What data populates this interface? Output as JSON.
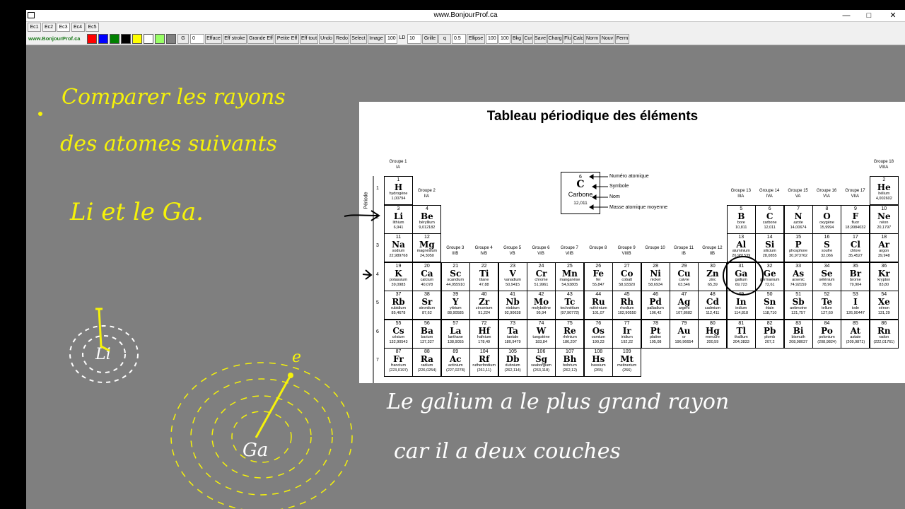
{
  "window": {
    "title": "www.BonjourProf.ca",
    "minimize": "—",
    "maximize": "□",
    "close": "✕"
  },
  "tabs": [
    {
      "label": "Ec1",
      "active": false
    },
    {
      "label": "Ec2",
      "active": false
    },
    {
      "label": "Ec3",
      "active": true
    },
    {
      "label": "Ec4",
      "active": false
    },
    {
      "label": "Ec5",
      "active": false
    }
  ],
  "toolbar": {
    "site": "www.BonjourProf.ca",
    "swatches": [
      "#ff0000",
      "#0000ff",
      "#008000",
      "#000000",
      "#ffff00",
      "#ffffff",
      "#99ff66",
      "#808080"
    ],
    "items": [
      {
        "text": "G",
        "kind": "btn"
      },
      {
        "text": "0",
        "kind": "val"
      },
      {
        "text": "Efface",
        "kind": "btn"
      },
      {
        "text": "Eff stroke",
        "kind": "btn"
      },
      {
        "text": "Grande Eff",
        "kind": "btn"
      },
      {
        "text": "Petite Eff",
        "kind": "btn"
      },
      {
        "text": "Eff tout",
        "kind": "btn"
      },
      {
        "text": "Undo",
        "kind": "btn"
      },
      {
        "text": "Redo",
        "kind": "btn"
      },
      {
        "text": "Select",
        "kind": "btn"
      },
      {
        "text": "Image",
        "kind": "btn"
      },
      {
        "text": "100",
        "kind": "val"
      },
      {
        "text": "LD",
        "kind": "lbl"
      },
      {
        "text": "10",
        "kind": "val"
      },
      {
        "text": "Grille",
        "kind": "btn"
      },
      {
        "text": "q",
        "kind": "btn"
      },
      {
        "text": "0.5",
        "kind": "val"
      },
      {
        "text": "Ellipse",
        "kind": "btn"
      },
      {
        "text": "100",
        "kind": "val"
      },
      {
        "text": "100",
        "kind": "val"
      },
      {
        "text": "Bkg",
        "kind": "btn"
      },
      {
        "text": "Cur",
        "kind": "btn"
      },
      {
        "text": "Save",
        "kind": "btn"
      },
      {
        "text": "Charg",
        "kind": "btn"
      },
      {
        "text": "Flu",
        "kind": "btn"
      },
      {
        "text": "Calc",
        "kind": "btn"
      },
      {
        "text": "Norm",
        "kind": "btn"
      },
      {
        "text": "Nouv",
        "kind": "btn"
      },
      {
        "text": "Ferm",
        "kind": "btn"
      }
    ]
  },
  "periodic_table": {
    "title": "Tableau périodique des éléments",
    "period_label": "Période",
    "legend": {
      "number": "6",
      "symbol": "C",
      "name": "Carbone",
      "mass": "12,011",
      "labels": [
        "Numéro atomique",
        "Symbole",
        "Nom",
        "Masse atomique moyenne"
      ]
    },
    "groups": [
      {
        "col": 1,
        "row": 1,
        "line1": "Groupe 1",
        "line2": "IA"
      },
      {
        "col": 2,
        "row": 2,
        "line1": "Groupe 2",
        "line2": "IIA"
      },
      {
        "col": 3,
        "row": 4,
        "line1": "Groupe 3",
        "line2": "IIIB"
      },
      {
        "col": 4,
        "row": 4,
        "line1": "Groupe 4",
        "line2": "IVB"
      },
      {
        "col": 5,
        "row": 4,
        "line1": "Groupe 5",
        "line2": "VB"
      },
      {
        "col": 6,
        "row": 4,
        "line1": "Groupe 6",
        "line2": "VIB"
      },
      {
        "col": 7,
        "row": 4,
        "line1": "Groupe 7",
        "line2": "VIIB"
      },
      {
        "col": 8,
        "row": 4,
        "line1": "Groupe 8",
        "line2": ""
      },
      {
        "col": 9,
        "row": 4,
        "line1": "Groupe 9",
        "line2": "VIIIB"
      },
      {
        "col": 10,
        "row": 4,
        "line1": "Groupe 10",
        "line2": ""
      },
      {
        "col": 11,
        "row": 4,
        "line1": "Groupe 11",
        "line2": "IB"
      },
      {
        "col": 12,
        "row": 4,
        "line1": "Groupe 12",
        "line2": "IIB"
      },
      {
        "col": 13,
        "row": 2,
        "line1": "Groupe 13",
        "line2": "IIIA"
      },
      {
        "col": 14,
        "row": 2,
        "line1": "Groupe 14",
        "line2": "IVA"
      },
      {
        "col": 15,
        "row": 2,
        "line1": "Groupe 15",
        "line2": "VA"
      },
      {
        "col": 16,
        "row": 2,
        "line1": "Groupe 16",
        "line2": "VIA"
      },
      {
        "col": 17,
        "row": 2,
        "line1": "Groupe 17",
        "line2": "VIIA"
      },
      {
        "col": 18,
        "row": 1,
        "line1": "Groupe 18",
        "line2": "VIIIA"
      }
    ],
    "periods": [
      "1",
      "2",
      "3",
      "4",
      "5",
      "6",
      "7"
    ],
    "elements": [
      {
        "n": "1",
        "s": "H",
        "name": "hydrogène",
        "m": "1,00794",
        "row": 1,
        "col": 1
      },
      {
        "n": "2",
        "s": "He",
        "name": "hélium",
        "m": "4,002602",
        "row": 1,
        "col": 18
      },
      {
        "n": "3",
        "s": "Li",
        "name": "lithium",
        "m": "6,941",
        "row": 2,
        "col": 1
      },
      {
        "n": "4",
        "s": "Be",
        "name": "béryllium",
        "m": "9,012182",
        "row": 2,
        "col": 2
      },
      {
        "n": "5",
        "s": "B",
        "name": "bore",
        "m": "10,811",
        "row": 2,
        "col": 13
      },
      {
        "n": "6",
        "s": "C",
        "name": "carbone",
        "m": "12,011",
        "row": 2,
        "col": 14
      },
      {
        "n": "7",
        "s": "N",
        "name": "azote",
        "m": "14,00674",
        "row": 2,
        "col": 15
      },
      {
        "n": "8",
        "s": "O",
        "name": "oxygène",
        "m": "15,9994",
        "row": 2,
        "col": 16
      },
      {
        "n": "9",
        "s": "F",
        "name": "fluor",
        "m": "18,9984032",
        "row": 2,
        "col": 17
      },
      {
        "n": "10",
        "s": "Ne",
        "name": "néon",
        "m": "20,1797",
        "row": 2,
        "col": 18
      },
      {
        "n": "11",
        "s": "Na",
        "name": "sodium",
        "m": "22,989768",
        "row": 3,
        "col": 1
      },
      {
        "n": "12",
        "s": "Mg",
        "name": "magnésium",
        "m": "24,3050",
        "row": 3,
        "col": 2
      },
      {
        "n": "13",
        "s": "Al",
        "name": "aluminium",
        "m": "26,981539",
        "row": 3,
        "col": 13
      },
      {
        "n": "14",
        "s": "Si",
        "name": "silicium",
        "m": "28,0855",
        "row": 3,
        "col": 14
      },
      {
        "n": "15",
        "s": "P",
        "name": "phosphore",
        "m": "30,973762",
        "row": 3,
        "col": 15
      },
      {
        "n": "16",
        "s": "S",
        "name": "soufre",
        "m": "32,066",
        "row": 3,
        "col": 16
      },
      {
        "n": "17",
        "s": "Cl",
        "name": "chlore",
        "m": "35,4527",
        "row": 3,
        "col": 17
      },
      {
        "n": "18",
        "s": "Ar",
        "name": "argon",
        "m": "39,948",
        "row": 3,
        "col": 18
      },
      {
        "n": "19",
        "s": "K",
        "name": "potassium",
        "m": "39,0983",
        "row": 4,
        "col": 1
      },
      {
        "n": "20",
        "s": "Ca",
        "name": "calcium",
        "m": "40,078",
        "row": 4,
        "col": 2
      },
      {
        "n": "21",
        "s": "Sc",
        "name": "scandium",
        "m": "44,955910",
        "row": 4,
        "col": 3
      },
      {
        "n": "22",
        "s": "Ti",
        "name": "titane",
        "m": "47,88",
        "row": 4,
        "col": 4
      },
      {
        "n": "23",
        "s": "V",
        "name": "vanadium",
        "m": "50,9415",
        "row": 4,
        "col": 5
      },
      {
        "n": "24",
        "s": "Cr",
        "name": "chrome",
        "m": "51,9961",
        "row": 4,
        "col": 6
      },
      {
        "n": "25",
        "s": "Mn",
        "name": "manganèse",
        "m": "54,93805",
        "row": 4,
        "col": 7
      },
      {
        "n": "26",
        "s": "Fe",
        "name": "fer",
        "m": "55,847",
        "row": 4,
        "col": 8
      },
      {
        "n": "27",
        "s": "Co",
        "name": "cobalt",
        "m": "58,93320",
        "row": 4,
        "col": 9
      },
      {
        "n": "28",
        "s": "Ni",
        "name": "nickel",
        "m": "58,6934",
        "row": 4,
        "col": 10
      },
      {
        "n": "29",
        "s": "Cu",
        "name": "cuivre",
        "m": "63,546",
        "row": 4,
        "col": 11
      },
      {
        "n": "30",
        "s": "Zn",
        "name": "zinc",
        "m": "65,39",
        "row": 4,
        "col": 12
      },
      {
        "n": "31",
        "s": "Ga",
        "name": "gallium",
        "m": "69,723",
        "row": 4,
        "col": 13
      },
      {
        "n": "32",
        "s": "Ge",
        "name": "germanium",
        "m": "72,61",
        "row": 4,
        "col": 14
      },
      {
        "n": "33",
        "s": "As",
        "name": "arsenic",
        "m": "74,92159",
        "row": 4,
        "col": 15
      },
      {
        "n": "34",
        "s": "Se",
        "name": "sélénium",
        "m": "78,96",
        "row": 4,
        "col": 16
      },
      {
        "n": "35",
        "s": "Br",
        "name": "brome",
        "m": "79,904",
        "row": 4,
        "col": 17
      },
      {
        "n": "36",
        "s": "Kr",
        "name": "krypton",
        "m": "83,80",
        "row": 4,
        "col": 18
      },
      {
        "n": "37",
        "s": "Rb",
        "name": "rubidium",
        "m": "85,4678",
        "row": 5,
        "col": 1
      },
      {
        "n": "38",
        "s": "Sr",
        "name": "strontium",
        "m": "87,62",
        "row": 5,
        "col": 2
      },
      {
        "n": "39",
        "s": "Y",
        "name": "yttrium",
        "m": "88,90585",
        "row": 5,
        "col": 3
      },
      {
        "n": "40",
        "s": "Zr",
        "name": "zirconium",
        "m": "91,224",
        "row": 5,
        "col": 4
      },
      {
        "n": "41",
        "s": "Nb",
        "name": "niobium",
        "m": "92,90638",
        "row": 5,
        "col": 5
      },
      {
        "n": "42",
        "s": "Mo",
        "name": "molybdène",
        "m": "95,94",
        "row": 5,
        "col": 6
      },
      {
        "n": "43",
        "s": "Tc",
        "name": "technétium",
        "m": "(97,90772)",
        "row": 5,
        "col": 7
      },
      {
        "n": "44",
        "s": "Ru",
        "name": "ruthénium",
        "m": "101,07",
        "row": 5,
        "col": 8
      },
      {
        "n": "45",
        "s": "Rh",
        "name": "rhodium",
        "m": "102,90550",
        "row": 5,
        "col": 9
      },
      {
        "n": "46",
        "s": "Pd",
        "name": "palladium",
        "m": "106,42",
        "row": 5,
        "col": 10
      },
      {
        "n": "47",
        "s": "Ag",
        "name": "argent",
        "m": "107,8682",
        "row": 5,
        "col": 11
      },
      {
        "n": "48",
        "s": "Cd",
        "name": "cadmium",
        "m": "112,411",
        "row": 5,
        "col": 12
      },
      {
        "n": "49",
        "s": "In",
        "name": "indium",
        "m": "114,818",
        "row": 5,
        "col": 13
      },
      {
        "n": "50",
        "s": "Sn",
        "name": "étain",
        "m": "118,710",
        "row": 5,
        "col": 14
      },
      {
        "n": "51",
        "s": "Sb",
        "name": "antimoine",
        "m": "121,757",
        "row": 5,
        "col": 15
      },
      {
        "n": "52",
        "s": "Te",
        "name": "tellure",
        "m": "127,60",
        "row": 5,
        "col": 16
      },
      {
        "n": "53",
        "s": "I",
        "name": "iode",
        "m": "126,90447",
        "row": 5,
        "col": 17
      },
      {
        "n": "54",
        "s": "Xe",
        "name": "xénon",
        "m": "131,29",
        "row": 5,
        "col": 18
      },
      {
        "n": "55",
        "s": "Cs",
        "name": "césium",
        "m": "132,90543",
        "row": 6,
        "col": 1
      },
      {
        "n": "56",
        "s": "Ba",
        "name": "barium",
        "m": "137,327",
        "row": 6,
        "col": 2
      },
      {
        "n": "57",
        "s": "La",
        "name": "lanthane",
        "m": "138,9055",
        "row": 6,
        "col": 3
      },
      {
        "n": "72",
        "s": "Hf",
        "name": "hafnium",
        "m": "178,49",
        "row": 6,
        "col": 4
      },
      {
        "n": "73",
        "s": "Ta",
        "name": "tantale",
        "m": "180,9479",
        "row": 6,
        "col": 5
      },
      {
        "n": "74",
        "s": "W",
        "name": "tungstène",
        "m": "183,84",
        "row": 6,
        "col": 6
      },
      {
        "n": "75",
        "s": "Re",
        "name": "rhénium",
        "m": "186,207",
        "row": 6,
        "col": 7
      },
      {
        "n": "76",
        "s": "Os",
        "name": "osmium",
        "m": "190,23",
        "row": 6,
        "col": 8
      },
      {
        "n": "77",
        "s": "Ir",
        "name": "iridium",
        "m": "192,22",
        "row": 6,
        "col": 9
      },
      {
        "n": "78",
        "s": "Pt",
        "name": "platine",
        "m": "195,08",
        "row": 6,
        "col": 10
      },
      {
        "n": "79",
        "s": "Au",
        "name": "or",
        "m": "196,96654",
        "row": 6,
        "col": 11
      },
      {
        "n": "80",
        "s": "Hg",
        "name": "mercure",
        "m": "200,59",
        "row": 6,
        "col": 12
      },
      {
        "n": "81",
        "s": "Tl",
        "name": "thallium",
        "m": "204,3833",
        "row": 6,
        "col": 13
      },
      {
        "n": "82",
        "s": "Pb",
        "name": "plomb",
        "m": "207,2",
        "row": 6,
        "col": 14
      },
      {
        "n": "83",
        "s": "Bi",
        "name": "bismuth",
        "m": "208,98037",
        "row": 6,
        "col": 15
      },
      {
        "n": "84",
        "s": "Po",
        "name": "polonium",
        "m": "(208,9824)",
        "row": 6,
        "col": 16
      },
      {
        "n": "85",
        "s": "At",
        "name": "astate",
        "m": "(209,9871)",
        "row": 6,
        "col": 17
      },
      {
        "n": "86",
        "s": "Rn",
        "name": "radon",
        "m": "(222,01761)",
        "row": 6,
        "col": 18
      },
      {
        "n": "87",
        "s": "Fr",
        "name": "francium",
        "m": "(223,0197)",
        "row": 7,
        "col": 1
      },
      {
        "n": "88",
        "s": "Ra",
        "name": "radium",
        "m": "(226,0254)",
        "row": 7,
        "col": 2
      },
      {
        "n": "89",
        "s": "Ac",
        "name": "actinium",
        "m": "(227,0278)",
        "row": 7,
        "col": 3
      },
      {
        "n": "104",
        "s": "Rf",
        "name": "rutherfordium",
        "m": "(261,11)",
        "row": 7,
        "col": 4
      },
      {
        "n": "105",
        "s": "Db",
        "name": "dubnium",
        "m": "(262,114)",
        "row": 7,
        "col": 5
      },
      {
        "n": "106",
        "s": "Sg",
        "name": "seaborgium",
        "m": "(263,118)",
        "row": 7,
        "col": 6
      },
      {
        "n": "107",
        "s": "Bh",
        "name": "bohrium",
        "m": "(262,12)",
        "row": 7,
        "col": 7
      },
      {
        "n": "108",
        "s": "Hs",
        "name": "hassium",
        "m": "(265)",
        "row": 7,
        "col": 8
      },
      {
        "n": "109",
        "s": "Mt",
        "name": "meitnerium",
        "m": "(266)",
        "row": 7,
        "col": 9
      }
    ]
  },
  "annotations": {
    "ink_color": "#f5f20a",
    "question_line1": "Comparer les rayons",
    "question_line2": "des atomes suivants",
    "question_line3": "Li et le Ga.",
    "answer_line1": "Le galium a le plus grand rayon",
    "answer_line2": "car il a deux couches",
    "li_label": "Li",
    "ga_label": "Ga",
    "electron_label": "e"
  }
}
